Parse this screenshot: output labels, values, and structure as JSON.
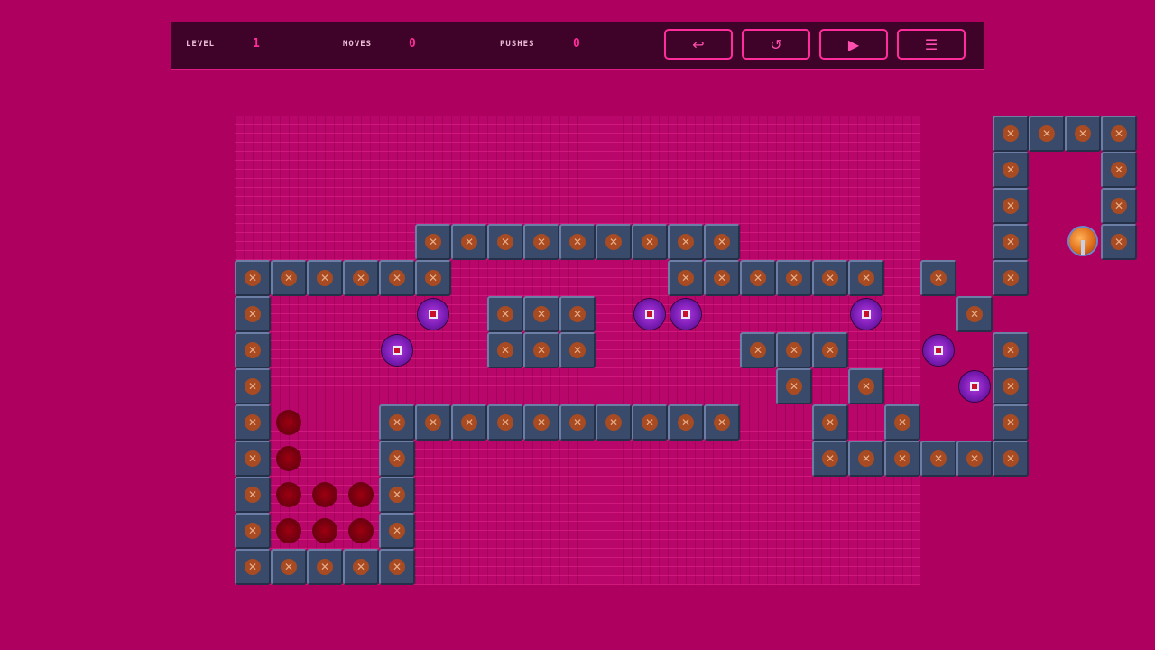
{
  "hud": {
    "level_label": "LEVEL",
    "level_value": "1",
    "moves_label": "MOVES",
    "moves_value": "0",
    "pushes_label": "PUSHES",
    "pushes_value": "0"
  },
  "buttons": {
    "undo": "↩",
    "restart": "↺",
    "play": "▶",
    "menu": "☰"
  },
  "colors": {
    "background": "#ad005f",
    "hud_background": "#3f0228",
    "accent": "#ff2c9a"
  },
  "level_map": [
    "                     ####",
    "                     #  #",
    "                     #  #",
    "     #########       # @#",
    "######      ###### # #",
    "#    $ ### $$    $  #",
    "#   $  ###    ###  $ #",
    "#              # #  $#",
    "#.  ##########  # #  #",
    "#.  #           ###### ",
    "#...#",
    "#...#",
    "#####"
  ]
}
